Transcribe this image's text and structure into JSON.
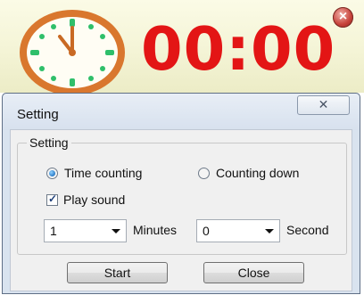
{
  "timer": {
    "time": "00:00",
    "close_glyph": "×",
    "icons": {
      "clock": "clock-icon",
      "close": "close-icon"
    },
    "colors": {
      "digits": "#e31515",
      "clock_rim": "#d9772e",
      "clock_marks": "#2fbf6a"
    }
  },
  "dialog": {
    "title": "Setting",
    "close_glyph": "✕",
    "group_label": "Setting",
    "mode_options": [
      {
        "label": "Time counting",
        "selected": true
      },
      {
        "label": "Counting down",
        "selected": false
      }
    ],
    "play_sound": {
      "label": "Play sound",
      "checked": true
    },
    "minutes": {
      "value": "1",
      "unit": "Minutes"
    },
    "seconds": {
      "value": "0",
      "unit": "Second"
    },
    "buttons": {
      "start": "Start",
      "close": "Close"
    }
  }
}
